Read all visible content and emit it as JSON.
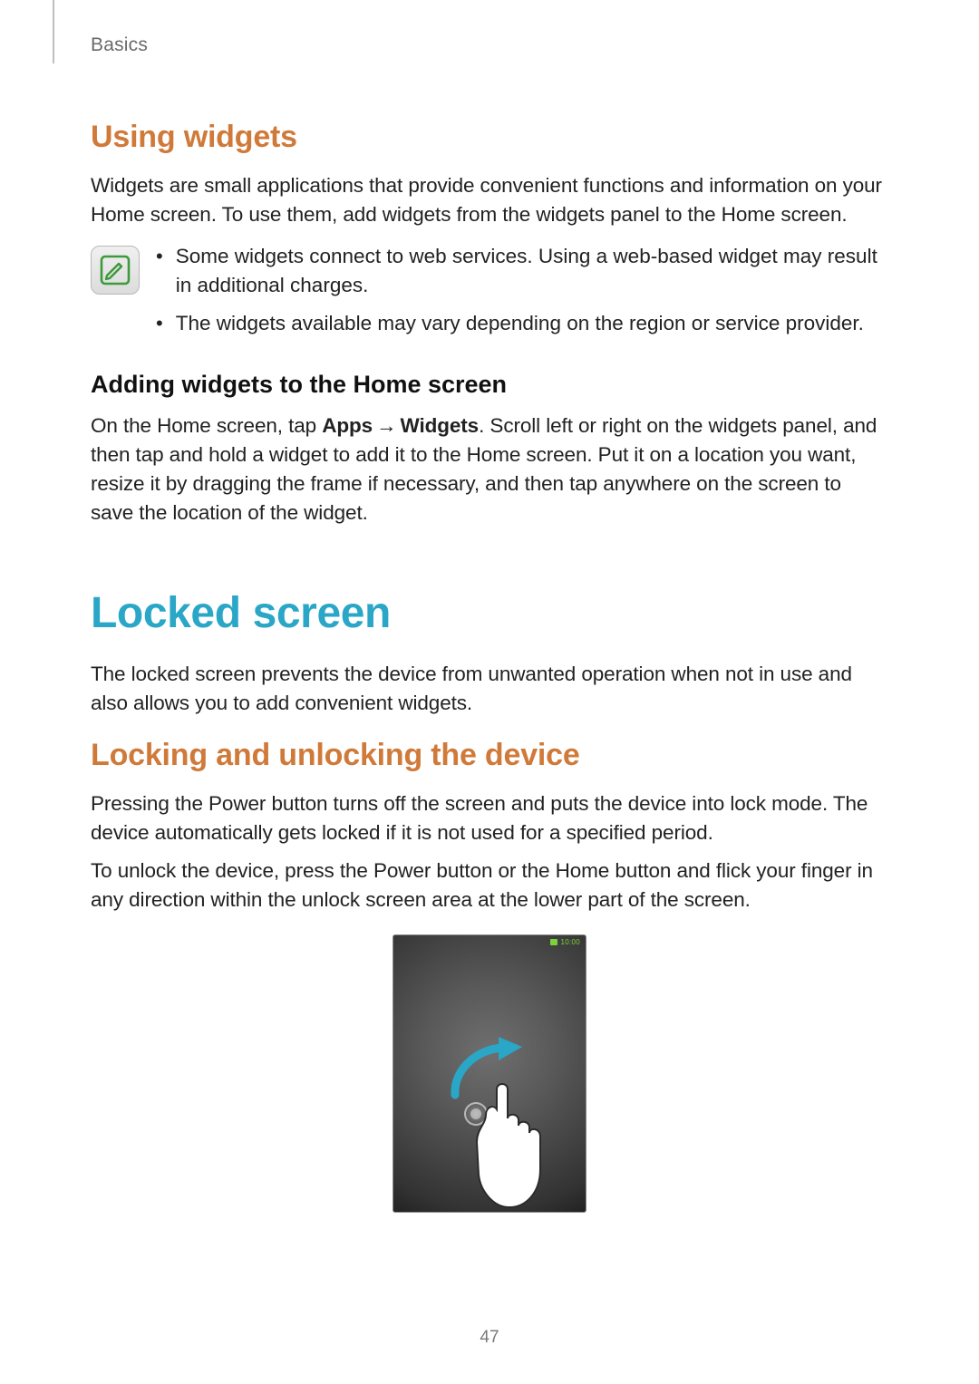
{
  "header": {
    "breadcrumb": "Basics"
  },
  "section_widgets": {
    "title": "Using widgets",
    "intro": "Widgets are small applications that provide convenient functions and information on your Home screen. To use them, add widgets from the widgets panel to the Home screen.",
    "note_icon": "note-icon",
    "notes": [
      "Some widgets connect to web services. Using a web-based widget may result in additional charges.",
      "The widgets available may vary depending on the region or service provider."
    ],
    "sub_title": "Adding widgets to the Home screen",
    "instruction_prefix": "On the Home screen, tap ",
    "instruction_apps": "Apps",
    "instruction_arrow": "→",
    "instruction_widgets": "Widgets",
    "instruction_suffix": ". Scroll left or right on the widgets panel, and then tap and hold a widget to add it to the Home screen. Put it on a location you want, resize it by dragging the frame if necessary, and then tap anywhere on the screen to save the location of the widget."
  },
  "section_locked": {
    "title": "Locked screen",
    "intro": "The locked screen prevents the device from unwanted operation when not in use and also allows you to add convenient widgets.",
    "sub_title": "Locking and unlocking the device",
    "para1": "Pressing the Power button turns off the screen and puts the device into lock mode. The device automatically gets locked if it is not used for a specified period.",
    "para2": "To unlock the device, press the Power button or the Home button and flick your finger in any direction within the unlock screen area at the lower part of the screen.",
    "device_time": "10:00"
  },
  "footer": {
    "page_number": "47"
  }
}
